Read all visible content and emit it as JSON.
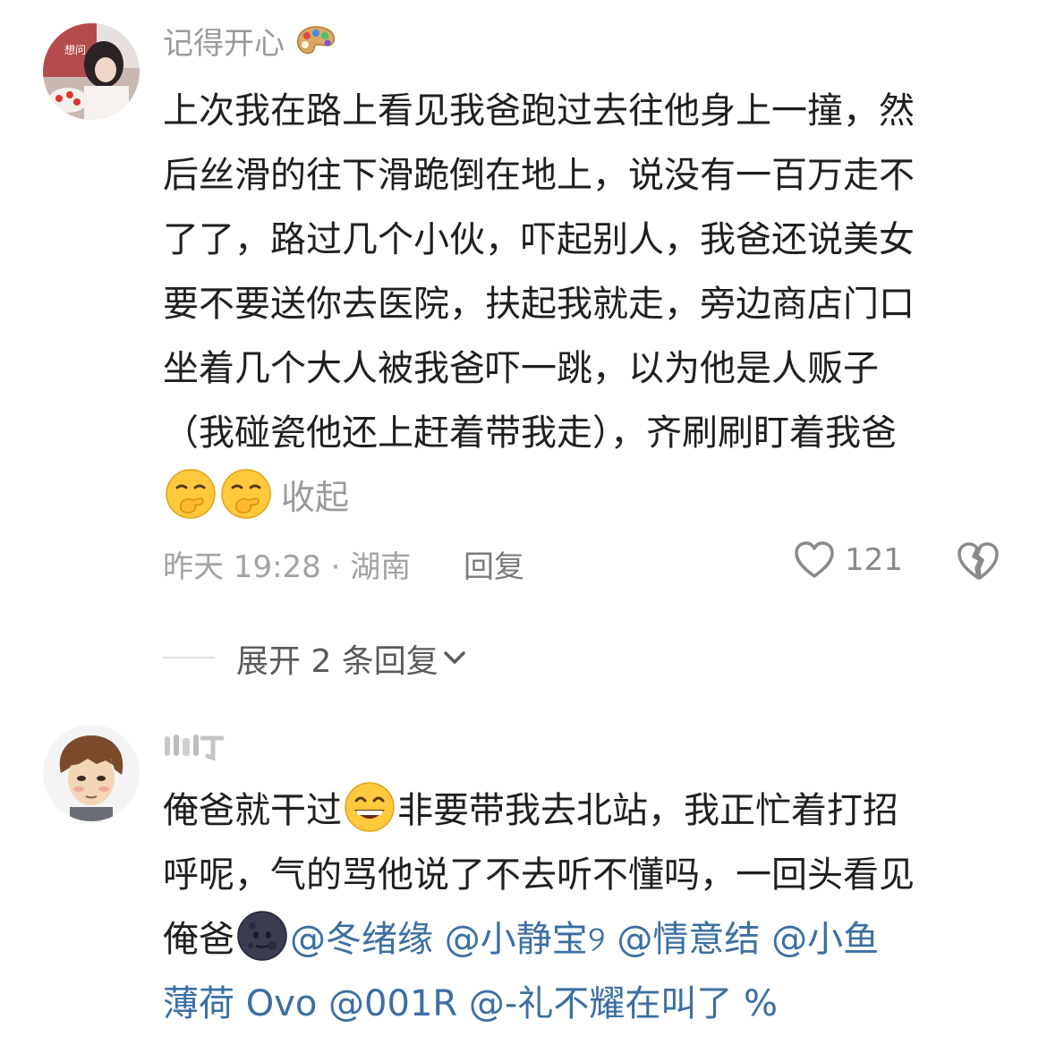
{
  "comments": [
    {
      "username": "记得开心",
      "username_emoji_icon": "palette-icon",
      "lines": [
        "上次我在路上看见我爸跑过去往他身上一撞，然",
        "后丝滑的往下滑跪倒在地上，说没有一百万走不",
        "了了，路过几个小伙，吓起别人，我爸还说美女",
        "要不要送你去医院，扶起我就走，旁边商店门口",
        "坐着几个大人被我爸吓一跳，以为他是人贩子",
        "（我碰瓷他还上赶着带我走），齐刷刷盯着我爸"
      ],
      "trailing_emoji_icons": [
        "hand-over-mouth-face-icon",
        "hand-over-mouth-face-icon"
      ],
      "collapse_label": "收起",
      "time_location": "昨天 19:28 · 湖南",
      "reply_label": "回复",
      "like_count": "121"
    },
    {
      "username": "",
      "line1_a": "俺爸就干过",
      "line1_emoji_icon": "grinning-face-icon",
      "line1_b": "非要带我去北站，我正忙着打招",
      "line2": "呼呢，气的骂他说了不去听不懂吗，一回头看见",
      "line3_a": "俺爸",
      "line3_emoji_icon": "new-moon-face-icon",
      "mentions_line3": "@冬绪缘 @小静宝୨ @情意结 @小鱼",
      "mentions_line4": "薄荷 Ovo @001R @-礼不耀在叫了 %"
    }
  ],
  "expand_replies_label": "展开 2 条回复",
  "colors": {
    "meta_text": "#a3a3a3",
    "mention": "#3b6fa3",
    "username": "#9a9a9a"
  }
}
